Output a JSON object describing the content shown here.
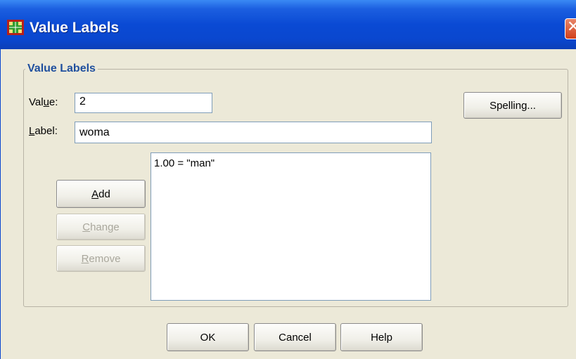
{
  "window": {
    "title": "Value Labels",
    "close_glyph": "✕"
  },
  "group": {
    "legend": "Value Labels"
  },
  "value_field": {
    "label_pre": "Val",
    "label_u": "u",
    "label_post": "e:",
    "value": "2"
  },
  "label_field": {
    "label_u": "L",
    "label_post": "abel:",
    "value": "woma"
  },
  "list": {
    "items": [
      "1.00 = \"man\""
    ]
  },
  "buttons": {
    "add": {
      "u": "A",
      "rest": "dd"
    },
    "change": {
      "u": "C",
      "rest": "hange"
    },
    "remove": {
      "u": "R",
      "rest": "emove"
    },
    "spelling": "Spelling...",
    "ok": "OK",
    "cancel": "Cancel",
    "help": "Help"
  },
  "colors": {
    "title_bar": "#0a4ad4",
    "dialog_bg": "#ece9d8",
    "legend_text": "#1f4f9e",
    "close_button": "#d2401a"
  },
  "icons": {
    "title": "spss-data-icon",
    "close": "close-icon"
  }
}
